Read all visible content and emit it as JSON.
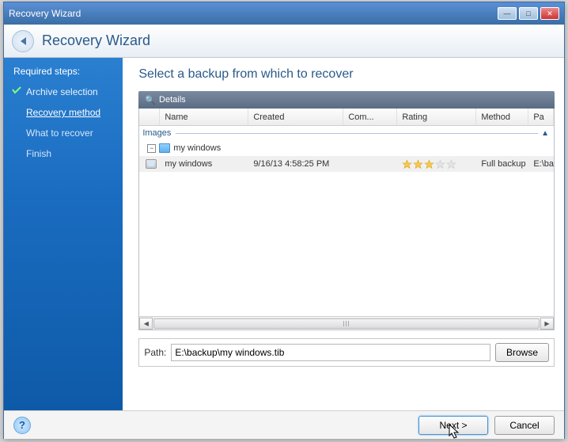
{
  "window": {
    "title": "Recovery Wizard"
  },
  "header": {
    "title": "Recovery Wizard"
  },
  "sidebar": {
    "header": "Required steps:",
    "steps": [
      {
        "label": "Archive selection",
        "state": "done"
      },
      {
        "label": "Recovery method",
        "state": "current"
      },
      {
        "label": "What to recover",
        "state": "pending"
      },
      {
        "label": "Finish",
        "state": "pending"
      }
    ],
    "faded": [
      "",
      ""
    ]
  },
  "main": {
    "title": "Select a backup from which to recover",
    "details_label": "Details",
    "columns": {
      "name": "Name",
      "created": "Created",
      "com": "Com...",
      "rating": "Rating",
      "method": "Method",
      "path": "Pa"
    },
    "group": "Images",
    "tree_root": "my windows",
    "row": {
      "name": "my windows",
      "created": "9/16/13 4:58:25 PM",
      "com": "",
      "rating": 3,
      "method": "Full backup",
      "path": "E:\\ba"
    },
    "path_label": "Path:",
    "path_value": "E:\\backup\\my windows.tib",
    "browse": "Browse"
  },
  "footer": {
    "next": "Next >",
    "cancel": "Cancel"
  }
}
